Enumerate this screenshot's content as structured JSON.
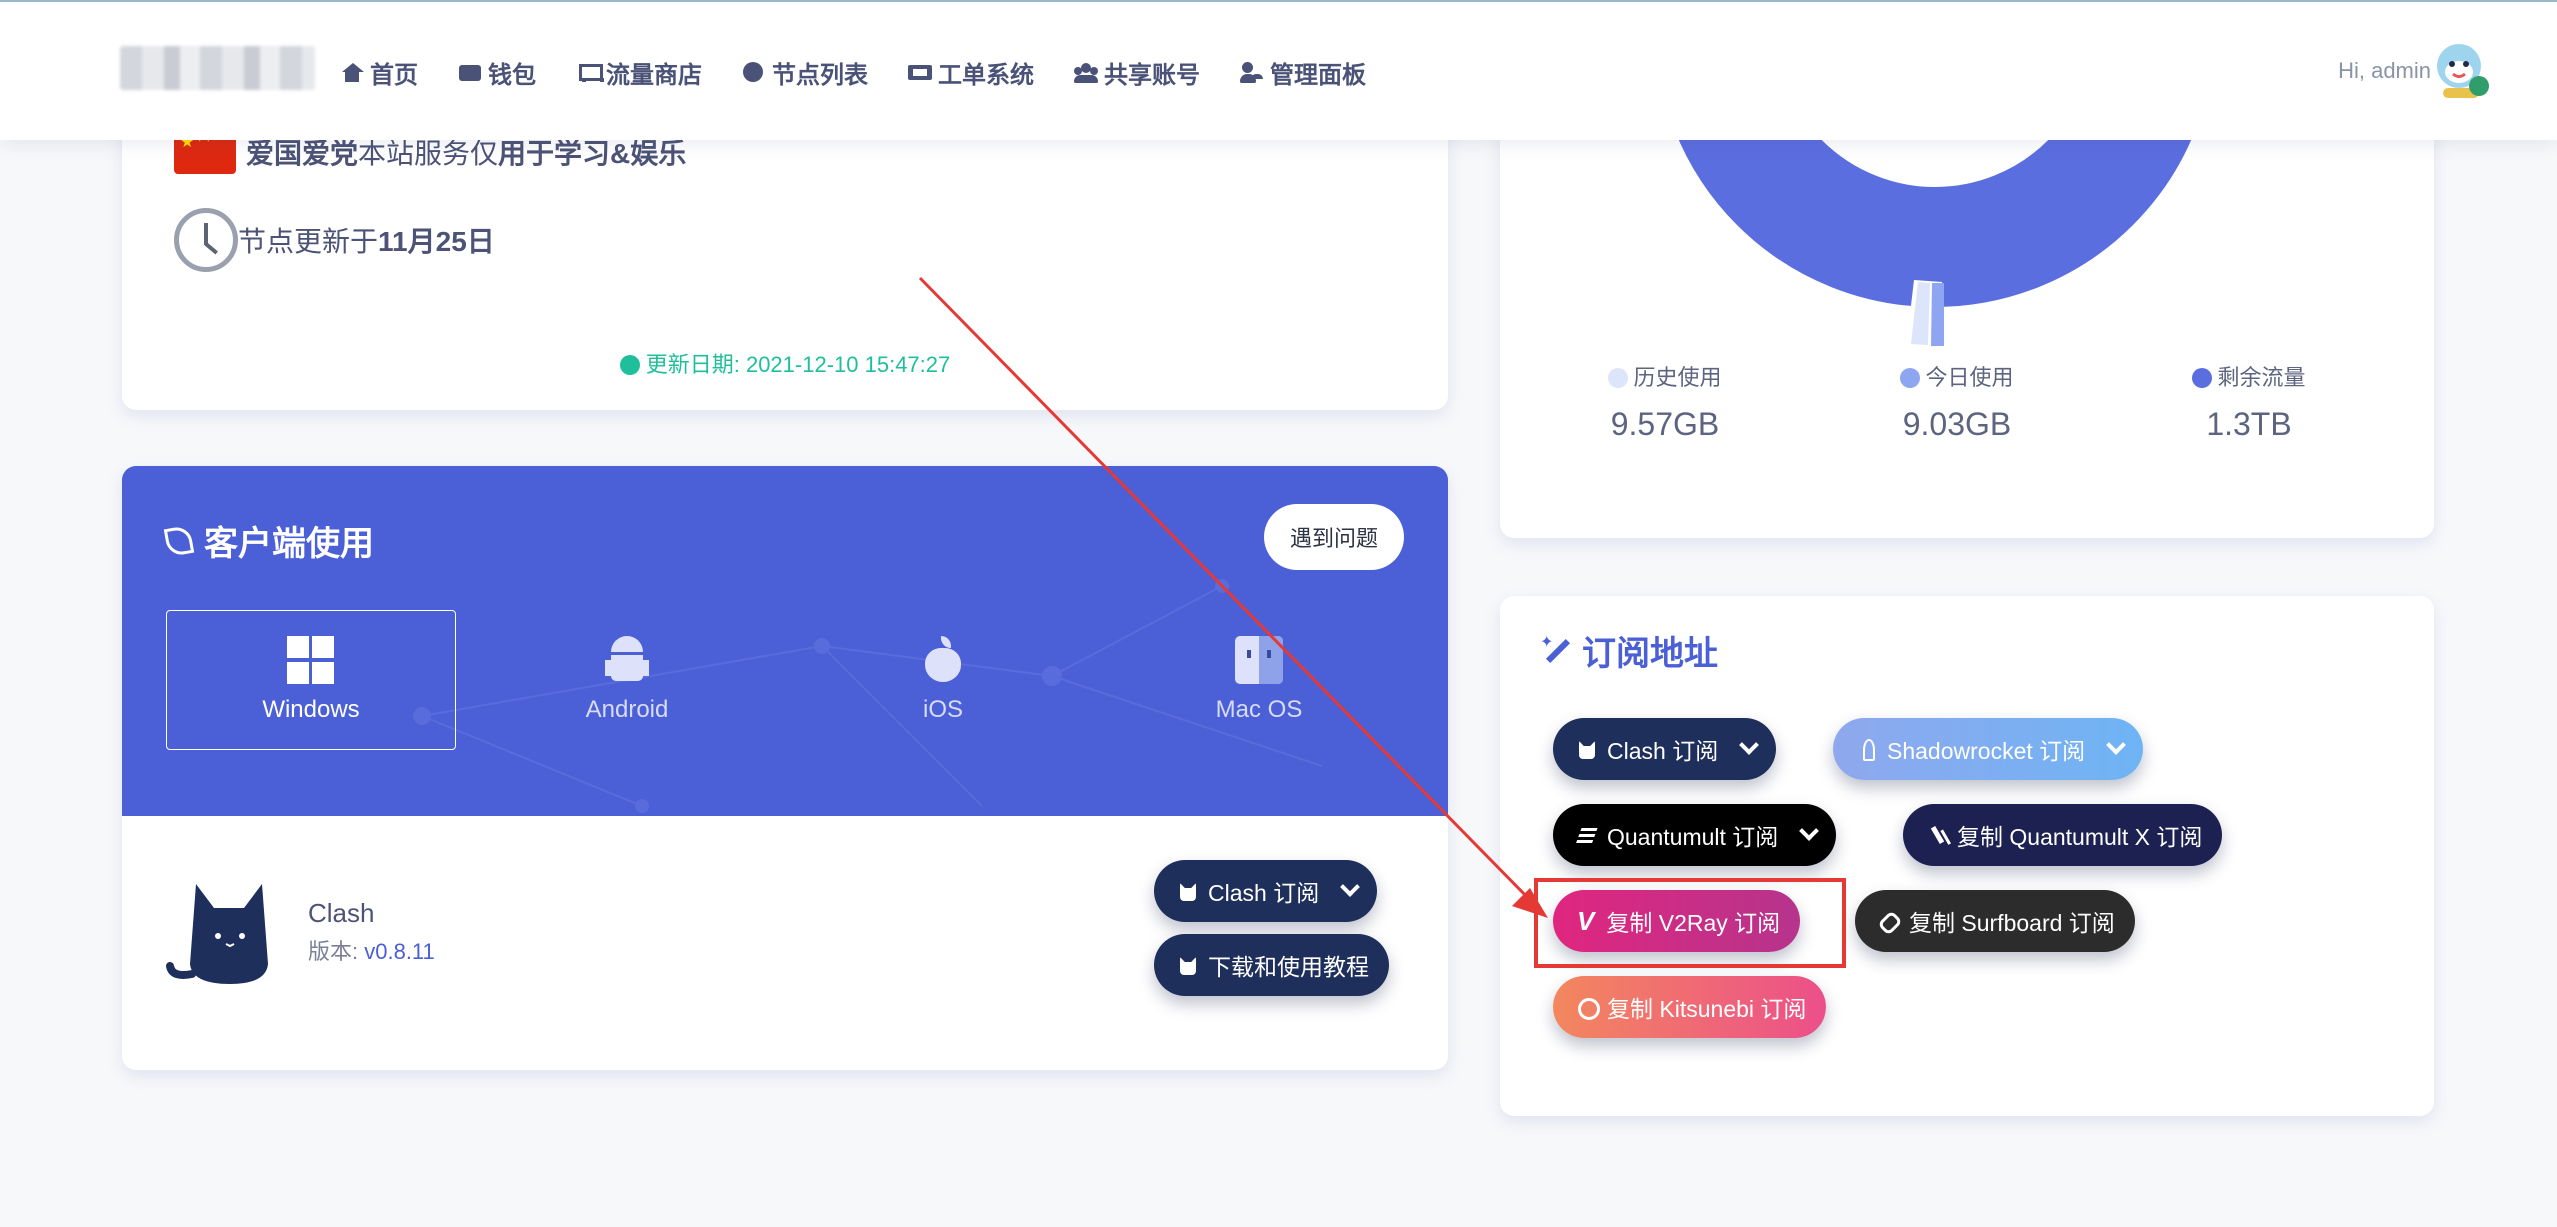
{
  "nav": {
    "items": [
      {
        "label": "首页",
        "icon": "home-icon"
      },
      {
        "label": "钱包",
        "icon": "wallet-icon"
      },
      {
        "label": "流量商店",
        "icon": "cart-icon"
      },
      {
        "label": "节点列表",
        "icon": "globe-icon"
      },
      {
        "label": "工单系统",
        "icon": "ticket-icon"
      },
      {
        "label": "共享账号",
        "icon": "users-icon"
      },
      {
        "label": "管理面板",
        "icon": "user-cog-icon"
      }
    ],
    "greeting": "Hi,  admin"
  },
  "notice": {
    "line1_bold1": "爱国爱党",
    "line1_mid": "本站服务仅",
    "line1_bold2": "用于学习&娱乐",
    "line2_text": "节点更新于",
    "line2_bold": "11月25日",
    "update_date": "更新日期: 2021-12-10 15:47:27"
  },
  "traffic": {
    "legend": [
      {
        "label": "历史使用",
        "value": "9.57GB",
        "color": "#dde5fb"
      },
      {
        "label": "今日使用",
        "value": "9.03GB",
        "color": "#8ea6f2"
      },
      {
        "label": "剩余流量",
        "value": "1.3TB",
        "color": "#5b6ee0"
      }
    ]
  },
  "client": {
    "title": "客户端使用",
    "problem_button": "遇到问题",
    "os_tabs": [
      {
        "label": "Windows",
        "icon": "windows-icon",
        "active": true
      },
      {
        "label": "Android",
        "icon": "android-icon",
        "active": false
      },
      {
        "label": "iOS",
        "icon": "apple-icon",
        "active": false
      },
      {
        "label": "Mac OS",
        "icon": "finder-icon",
        "active": false
      }
    ],
    "app_name": "Clash",
    "version_label": "版本: ",
    "version_value": "v0.8.11",
    "subscribe_button": "Clash 订阅",
    "tutorial_button": "下载和使用教程"
  },
  "subscription": {
    "title": "订阅地址",
    "buttons": {
      "clash": "Clash 订阅",
      "shadowrocket": "Shadowrocket 订阅",
      "quantumult": "Quantumult 订阅",
      "quantumult_x": "复制 Quantumult X 订阅",
      "v2ray": "复制 V2Ray 订阅",
      "surfboard": "复制 Surfboard 订阅",
      "kitsunebi": "复制 Kitsunebi 订阅"
    }
  },
  "colors": {
    "accent": "#4b5fd6",
    "clash_pill": "#1e2f5c",
    "shadowrocket_pill": "#7aa7f0",
    "quantumult_pill": "#000000",
    "quantumult_x_pill": "#1c2152",
    "v2ray_pill": "#d0307c",
    "surfboard_pill": "#2c2c2c",
    "kitsunebi_pill": "#f07b6e",
    "annotation_red": "#e53935"
  }
}
